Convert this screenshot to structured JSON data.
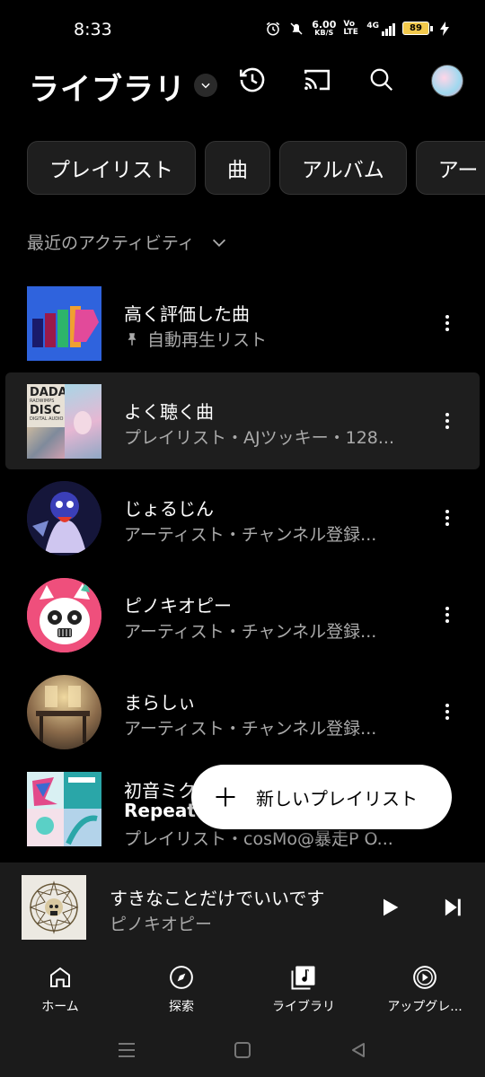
{
  "status_bar": {
    "time": "8:33",
    "net_speed": "6.00",
    "net_unit": "KB/S",
    "volte": "Vo LTE",
    "network": "4G",
    "battery": "89"
  },
  "header": {
    "title": "ライブラリ"
  },
  "chips": [
    "プレイリスト",
    "曲",
    "アルバム",
    "アー"
  ],
  "sort": {
    "label": "最近のアクティビティ"
  },
  "items": [
    {
      "title": "高く評価した曲",
      "subtitle": "自動再生リスト",
      "pinned": true
    },
    {
      "title": "よく聴く曲",
      "subtitle": "プレイリスト・AJツッキー・128..."
    },
    {
      "title": "じょるじん",
      "subtitle": "アーティスト・チャンネル登録..."
    },
    {
      "title": "ピノキオピー",
      "subtitle": "アーティスト・チャンネル登録..."
    },
    {
      "title": "まらしぃ",
      "subtitle": "アーティスト・チャンネル登録..."
    },
    {
      "title": "初音ミク",
      "title2": "Repeat-",
      "subtitle": "プレイリスト・cosMo@暴走P O..."
    }
  ],
  "thumb_text": {
    "dada": "DADA",
    "radwimps": "RADWIMPS",
    "disc": "DISC",
    "digital_audio": "DIGITAL AUDIO"
  },
  "fab": {
    "label": "新しいプレイリスト"
  },
  "mini_player": {
    "title": "すきなことだけでいいです",
    "artist": "ピノキオピー"
  },
  "bottom_nav": [
    {
      "label": "ホーム",
      "icon": "home-icon"
    },
    {
      "label": "探索",
      "icon": "compass-icon"
    },
    {
      "label": "ライブラリ",
      "icon": "library-icon"
    },
    {
      "label": "アップグレ...",
      "icon": "upgrade-icon"
    }
  ],
  "colors": {
    "background": "#000000",
    "surface": "#1b1b1b",
    "chip": "#1e1e1e",
    "secondary_text": "#aaaaaa",
    "fab": "#ffffff"
  }
}
